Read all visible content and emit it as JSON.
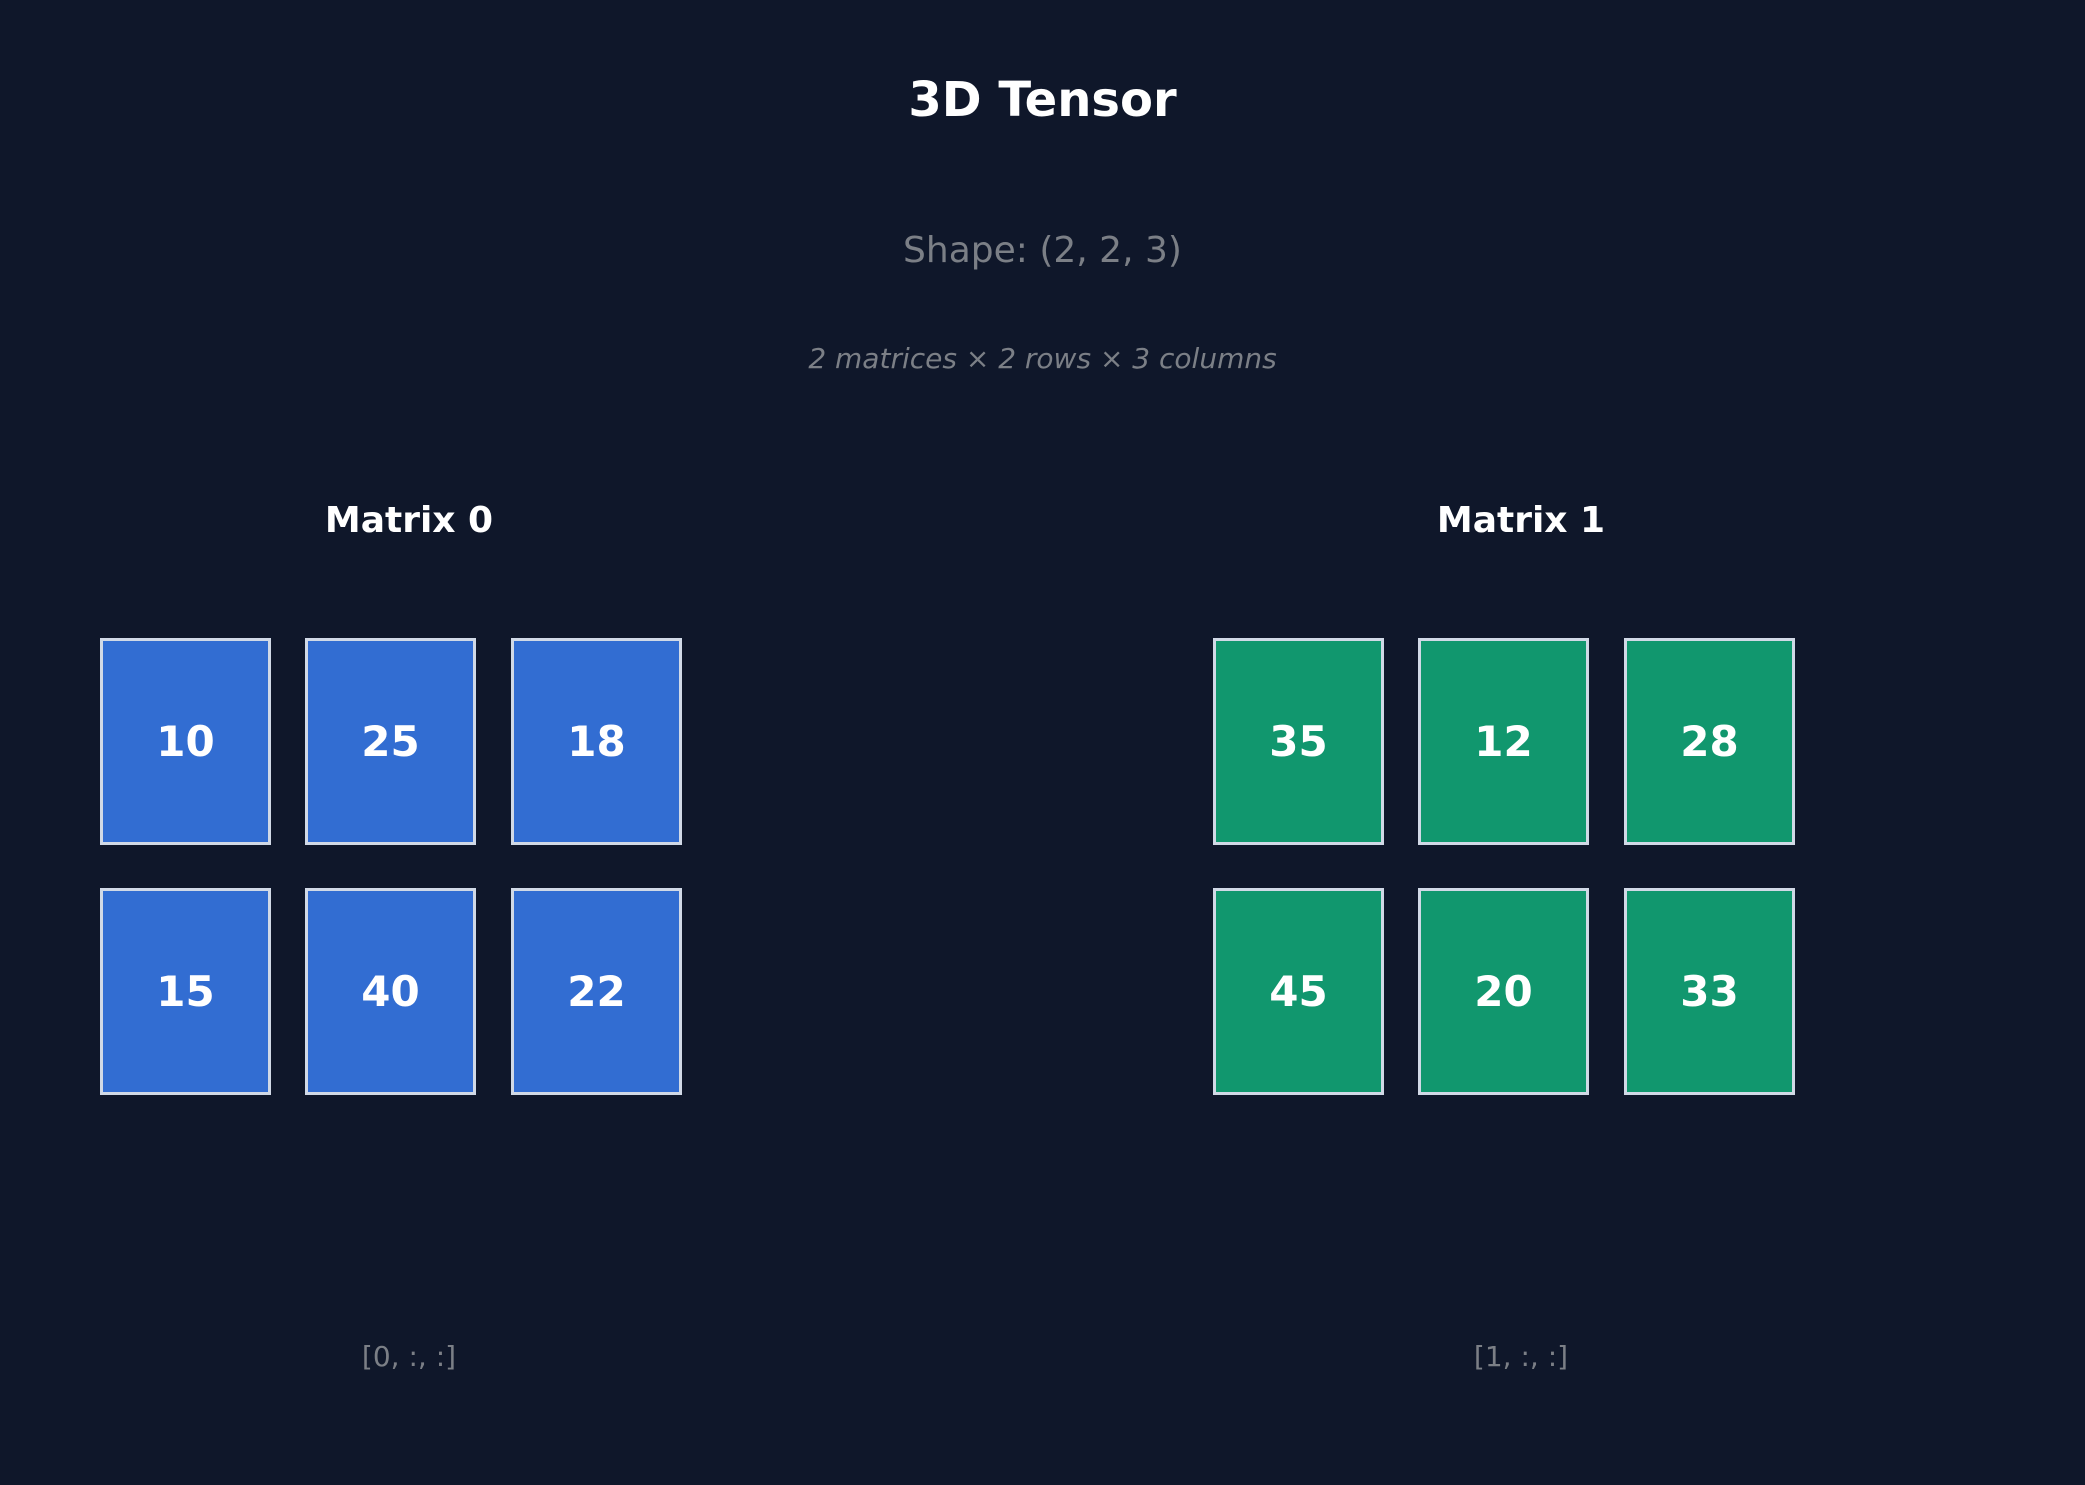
{
  "title": "3D Tensor",
  "shape_label": "Shape: (2, 2, 3)",
  "description": "2 matrices × 2 rows × 3 columns",
  "colors": {
    "background": "#0f172a",
    "matrix0": "#326dd2",
    "matrix1": "#11976e",
    "cell_border": "#d1d9e6"
  },
  "matrices": [
    {
      "label": "Matrix 0",
      "index": "[0, :, :]",
      "rows": [
        [
          "10",
          "25",
          "18"
        ],
        [
          "15",
          "40",
          "22"
        ]
      ]
    },
    {
      "label": "Matrix 1",
      "index": "[1, :, :]",
      "rows": [
        [
          "35",
          "12",
          "28"
        ],
        [
          "45",
          "20",
          "33"
        ]
      ]
    }
  ]
}
